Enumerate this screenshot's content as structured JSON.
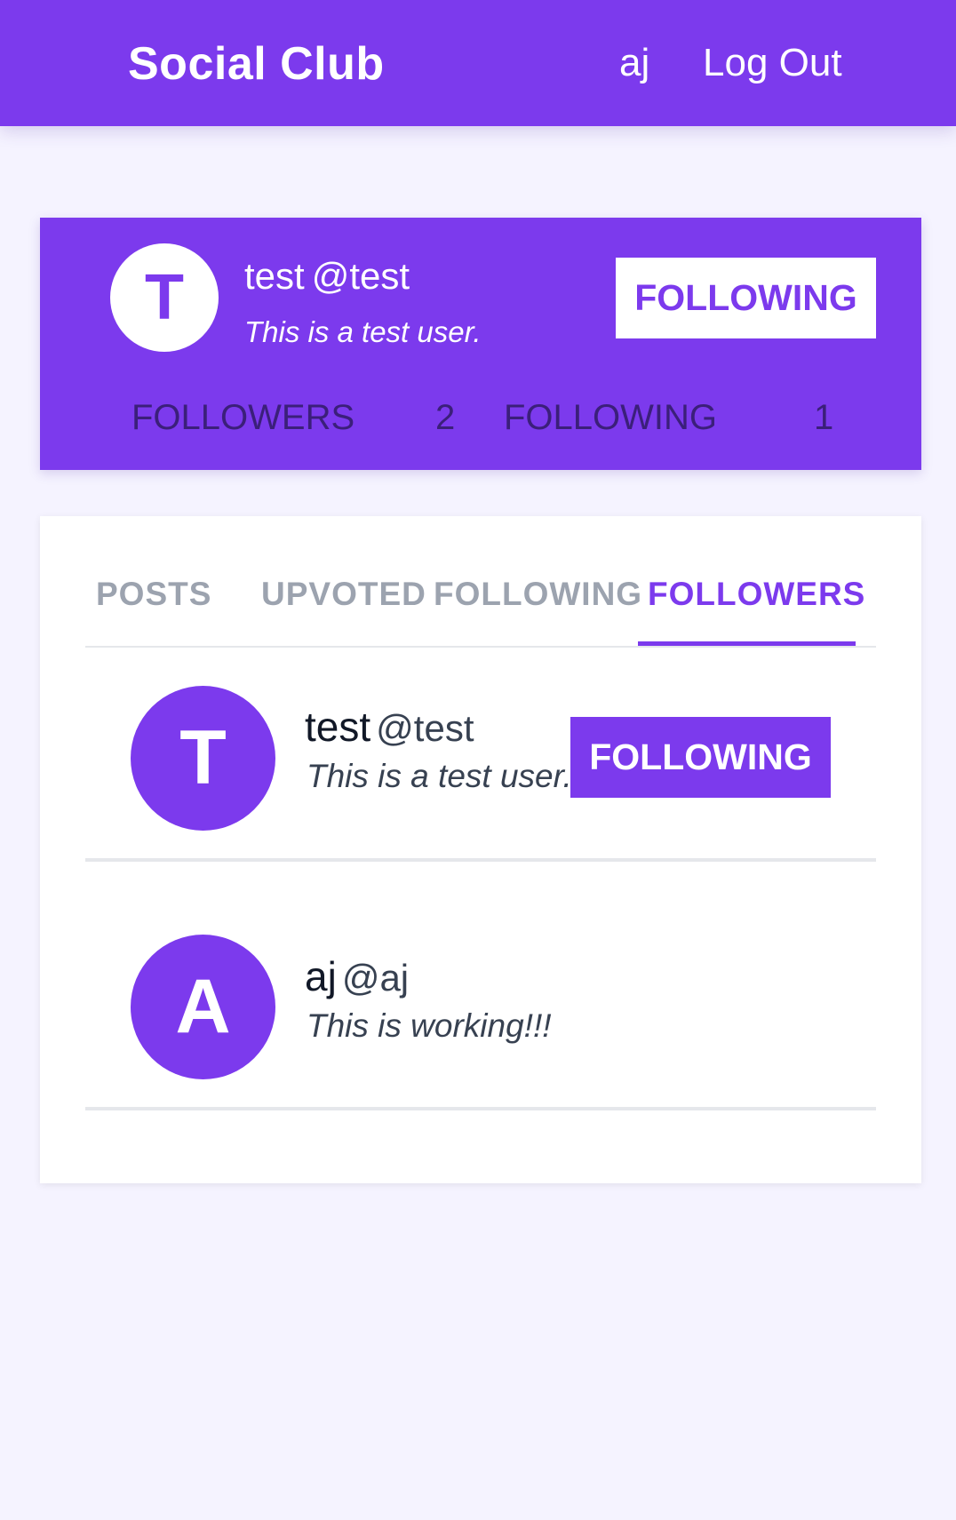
{
  "header": {
    "brand": "Social Club",
    "user": "aj",
    "logout": "Log Out"
  },
  "profile": {
    "avatar_letter": "T",
    "name": "test",
    "handle": "@test",
    "bio": "This is a test user.",
    "follow_button": "FOLLOWING",
    "followers_label": "FOLLOWERS",
    "followers_count": "2",
    "following_label": "FOLLOWING",
    "following_count": "1"
  },
  "tabs": [
    {
      "label": "POSTS",
      "active": false
    },
    {
      "label": "UPVOTED",
      "active": false
    },
    {
      "label": "FOLLOWING",
      "active": false
    },
    {
      "label": "FOLLOWERS",
      "active": true
    }
  ],
  "followers": [
    {
      "avatar_letter": "T",
      "name": "test",
      "handle": "@test",
      "bio": "This is a test user.",
      "button": "FOLLOWING"
    },
    {
      "avatar_letter": "A",
      "name": "aj",
      "handle": "@aj",
      "bio": "This is working!!!"
    }
  ],
  "colors": {
    "accent": "#7c3aed",
    "background": "#f5f3ff",
    "muted_tab": "#9ca3af"
  }
}
